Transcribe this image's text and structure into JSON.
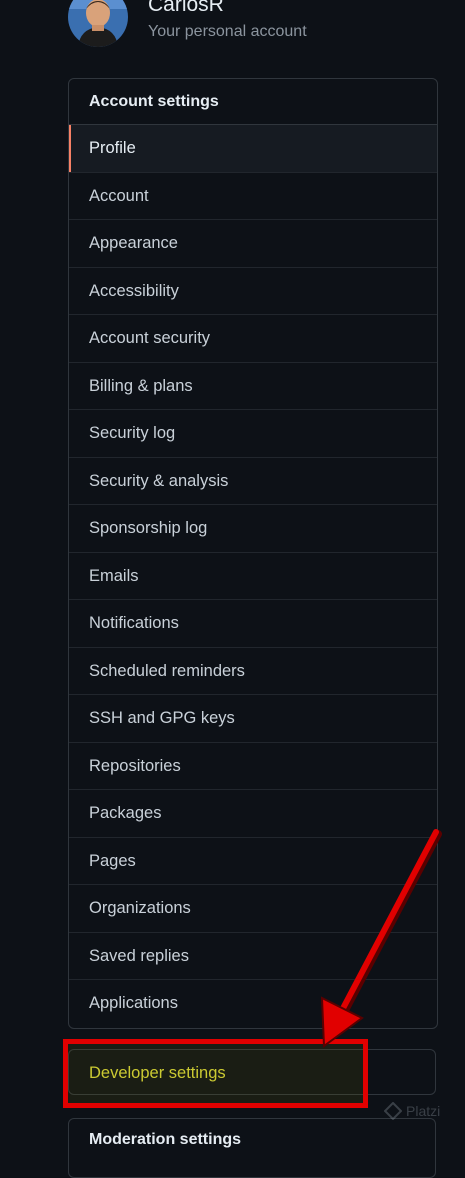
{
  "user": {
    "name": "CarlosR",
    "subtitle": "Your personal account"
  },
  "account_settings": {
    "header": "Account settings",
    "items": [
      {
        "label": "Profile",
        "selected": true
      },
      {
        "label": "Account"
      },
      {
        "label": "Appearance"
      },
      {
        "label": "Accessibility"
      },
      {
        "label": "Account security"
      },
      {
        "label": "Billing & plans"
      },
      {
        "label": "Security log"
      },
      {
        "label": "Security & analysis"
      },
      {
        "label": "Sponsorship log"
      },
      {
        "label": "Emails"
      },
      {
        "label": "Notifications"
      },
      {
        "label": "Scheduled reminders"
      },
      {
        "label": "SSH and GPG keys"
      },
      {
        "label": "Repositories"
      },
      {
        "label": "Packages"
      },
      {
        "label": "Pages"
      },
      {
        "label": "Organizations"
      },
      {
        "label": "Saved replies"
      },
      {
        "label": "Applications"
      }
    ]
  },
  "developer_settings": {
    "label": "Developer settings",
    "annotation_color": "#e10000"
  },
  "moderation_settings": {
    "header": "Moderation settings"
  },
  "watermark": {
    "text": "Platzi",
    "icon": "platzi-logo-icon"
  },
  "colors": {
    "background": "#0d1117",
    "border": "#30363d",
    "selected_indicator": "#f78166",
    "highlight_text": "#d7d53a"
  }
}
